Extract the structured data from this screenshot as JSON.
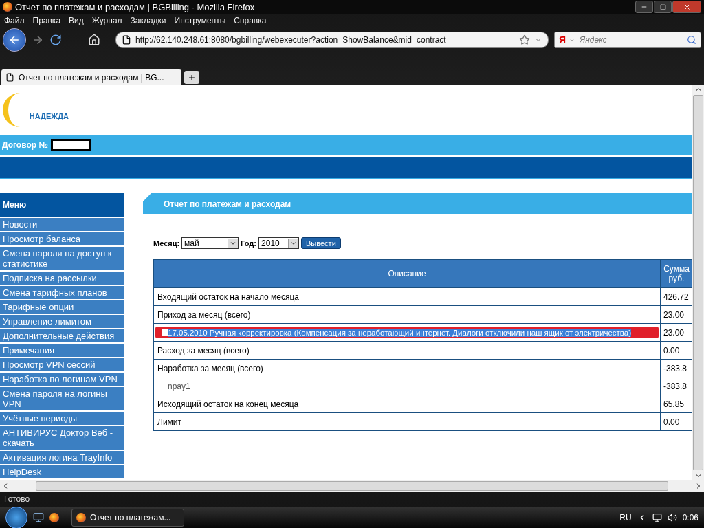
{
  "window": {
    "title": "Отчет по платежам и расходам | BGBilling - Mozilla Firefox"
  },
  "menu_bar": [
    "Файл",
    "Правка",
    "Вид",
    "Журнал",
    "Закладки",
    "Инструменты",
    "Справка"
  ],
  "address_bar": {
    "value": "http://62.140.248.61:8080/bgbilling/webexecuter?action=ShowBalance&mid=contract"
  },
  "search": {
    "engine_label": "Я",
    "placeholder": "Яндекс"
  },
  "tabs": [
    {
      "label": "Отчет по платежам и расходам | BG...",
      "selected": true
    }
  ],
  "page": {
    "logo_text": "НАДЕЖДА",
    "contract_label": "Договор №",
    "sidebar": {
      "title": "Меню",
      "items": [
        "Новости",
        "Просмотр баланса",
        "Смена пароля на доступ к статистике",
        "Подписка на рассылки",
        "Смена тарифных планов",
        "Тарифные опции",
        "Управление лимитом",
        "Дополнительные действия",
        "Примечания",
        "Просмотр VPN сессий",
        "Наработка по логинам VPN",
        "Смена пароля на логины VPN",
        "Учётные периоды",
        "АНТИВИРУС Доктор Веб - скачать",
        "Активация логина TrayInfo",
        "HelpDesk"
      ]
    },
    "panel_title": "Отчет по платежам и расходам",
    "filters": {
      "month_label": "Месяц:",
      "month": "май",
      "year_label": "Год:",
      "year": "2010",
      "submit": "Вывести"
    },
    "table": {
      "columns": [
        "Описание",
        "Сумма руб."
      ],
      "rows": [
        {
          "kind": "total",
          "description": "Входящий остаток на начало месяца",
          "amount": "426.72"
        },
        {
          "kind": "total",
          "description": "Приход за месяц (всего)",
          "amount": "23.00"
        },
        {
          "kind": "highlighted",
          "description": "17.05.2010 Ручная корректировка (Компенсация за неработающий интернет. Диалоги отключили наш ящик от электричества)",
          "amount": "23.00"
        },
        {
          "kind": "total",
          "description": "Расход за месяц (всего)",
          "amount": "0.00"
        },
        {
          "kind": "total",
          "description": "Наработка за месяц (всего)",
          "amount": "-383.8"
        },
        {
          "kind": "sub",
          "description": "npay1",
          "amount": "-383.8"
        },
        {
          "kind": "total",
          "description": "Исходящий остаток на конец месяца",
          "amount": "65.85"
        },
        {
          "kind": "total",
          "description": "Лимит",
          "amount": "0.00"
        }
      ]
    }
  },
  "status_bar": "Готово",
  "taskbar": {
    "window_button": "Отчет по платежам...",
    "language": "RU",
    "clock": "0:06"
  }
}
